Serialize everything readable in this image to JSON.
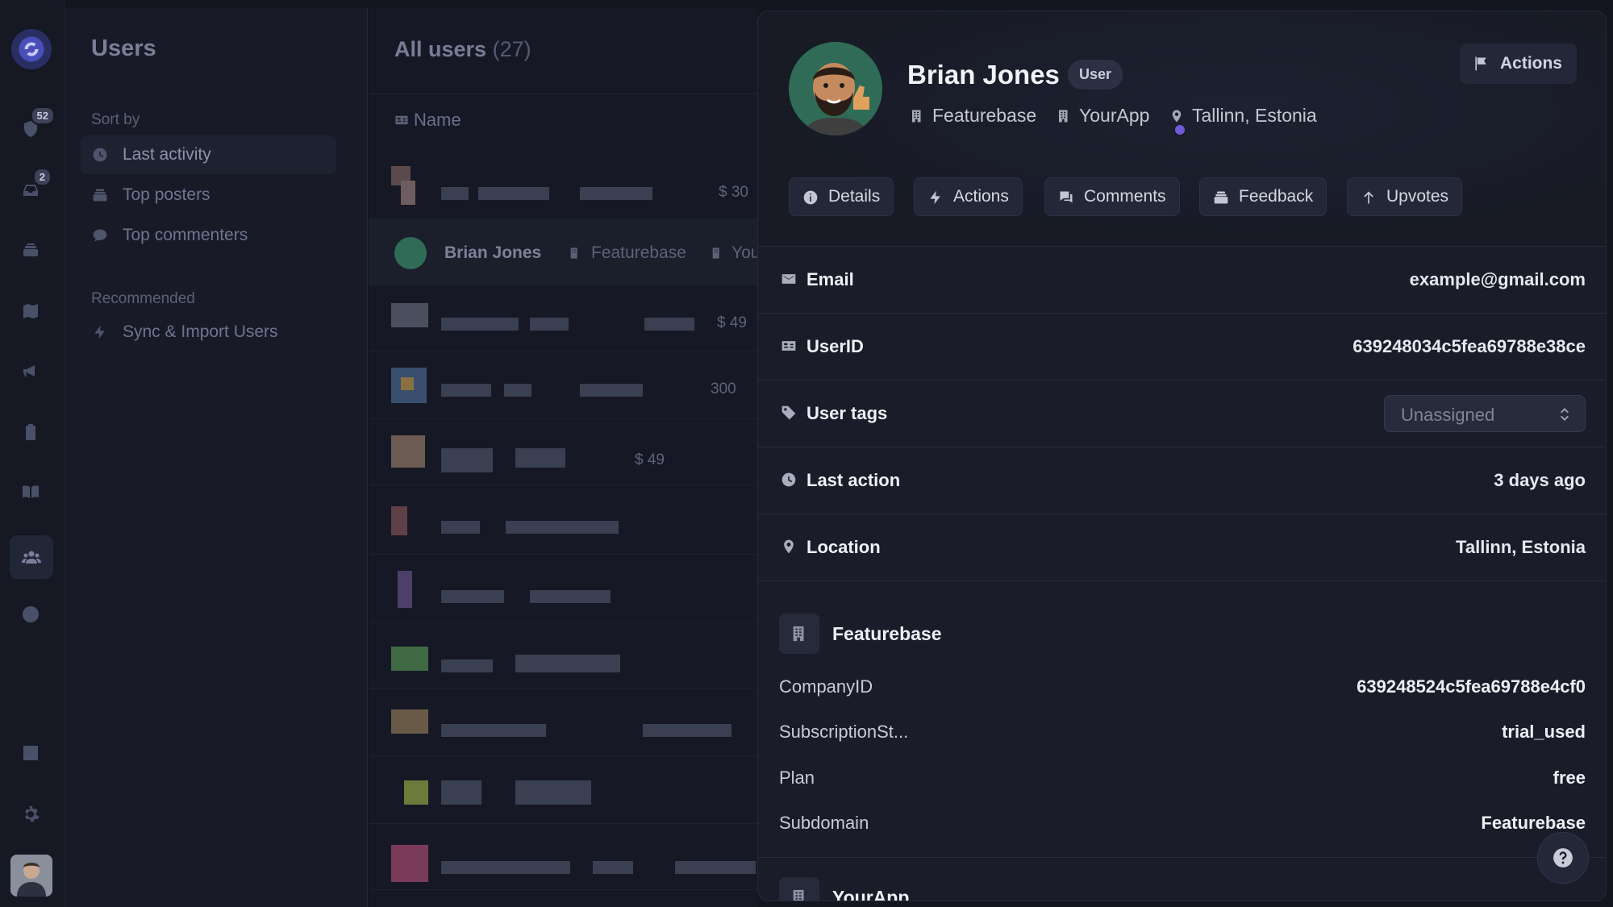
{
  "sidebar": {
    "title": "Users",
    "sort_by_label": "Sort by",
    "sort_items": [
      {
        "label": "Last activity",
        "icon": "clock-icon",
        "selected": true
      },
      {
        "label": "Top posters",
        "icon": "inbox-stack-icon",
        "selected": false
      },
      {
        "label": "Top commenters",
        "icon": "chat-bubble-icon",
        "selected": false
      }
    ],
    "recommended_label": "Recommended",
    "recommended_items": [
      {
        "label": "Sync & Import Users",
        "icon": "bolt-icon"
      }
    ]
  },
  "rail": {
    "badges": {
      "approvals": "52",
      "inbox": "2"
    }
  },
  "list": {
    "title": "All users",
    "count": "(27)",
    "column_name": "Name",
    "rows": [
      {
        "amount": "$ 30"
      },
      {
        "name": "Brian Jones",
        "company1": "Featurebase",
        "company2": "You"
      },
      {
        "amount": "$ 49"
      },
      {
        "amount": "300"
      },
      {
        "amount": "$ 49"
      }
    ]
  },
  "panel": {
    "user_name": "Brian Jones",
    "role_badge": "User",
    "companies": [
      "Featurebase",
      "YourApp"
    ],
    "location": "Tallinn, Estonia",
    "actions_button": "Actions",
    "tabs": [
      {
        "label": "Details",
        "icon": "info-icon"
      },
      {
        "label": "Actions",
        "icon": "bolt-icon"
      },
      {
        "label": "Comments",
        "icon": "chat-bubbles-icon"
      },
      {
        "label": "Feedback",
        "icon": "inbox-stack-icon"
      },
      {
        "label": "Upvotes",
        "icon": "arrow-up-icon"
      }
    ],
    "fields": {
      "email": {
        "label": "Email",
        "value": "example@gmail.com"
      },
      "userid": {
        "label": "UserID",
        "value": "639248034c5fea69788e38ce"
      },
      "tags": {
        "label": "User tags",
        "value": "Unassigned"
      },
      "last_action": {
        "label": "Last action",
        "value": "3 days ago"
      },
      "location": {
        "label": "Location",
        "value": "Tallinn, Estonia"
      }
    },
    "company_featurebase": {
      "name": "Featurebase",
      "props": [
        {
          "key": "CompanyID",
          "value": "639248524c5fea69788e4cf0"
        },
        {
          "key": "SubscriptionSt...",
          "value": "trial_used"
        },
        {
          "key": "Plan",
          "value": "free"
        },
        {
          "key": "Subdomain",
          "value": "Featurebase"
        }
      ]
    },
    "company_yourapp": {
      "name": "YourApp"
    }
  },
  "colors": {
    "background": "#13151f",
    "panel": "#1a1d29",
    "accent": "#6f5bd6",
    "avatar_bg": "#2f6b56"
  }
}
